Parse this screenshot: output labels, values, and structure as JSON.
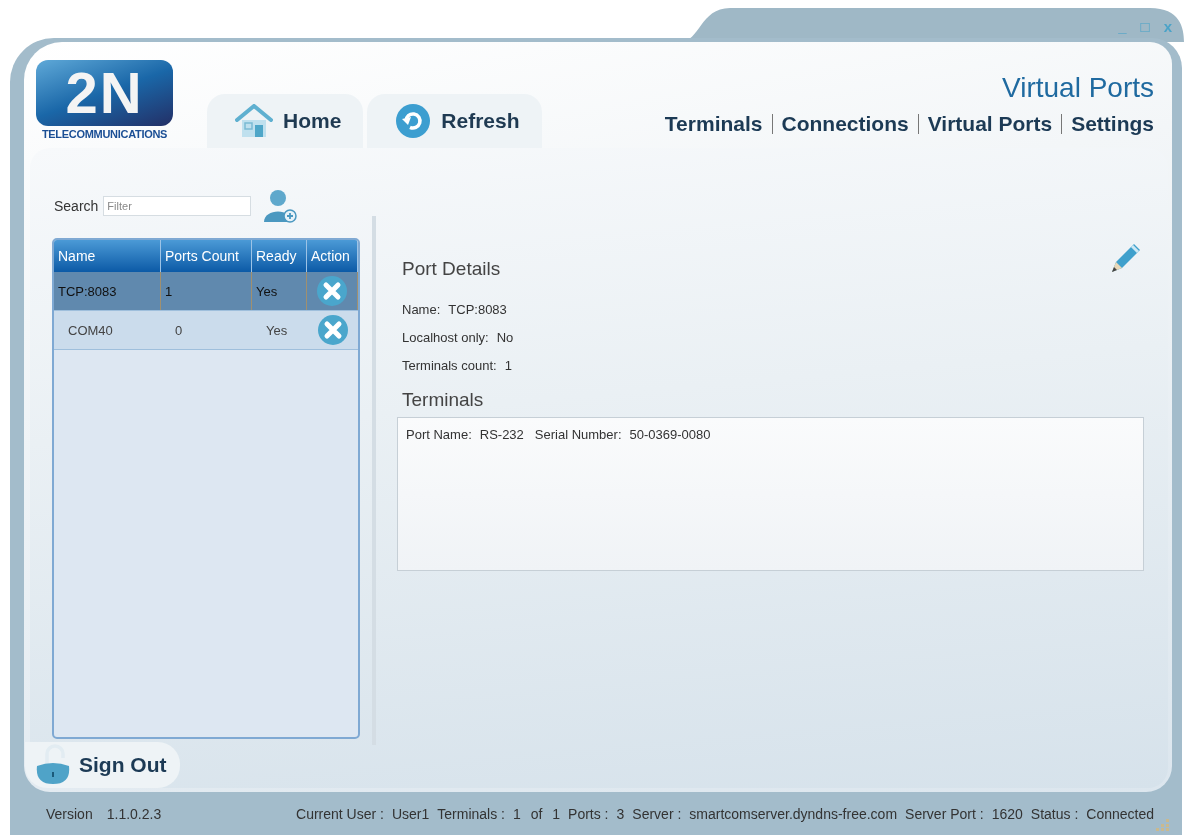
{
  "logo": {
    "mark": "2N",
    "caption": "TELECOMMUNICATIONS"
  },
  "window_controls": [
    "_",
    "□",
    "x"
  ],
  "toolbar": [
    {
      "label": "Home",
      "kind": "home"
    },
    {
      "label": "Refresh",
      "kind": "refresh"
    }
  ],
  "page_title": "Virtual Ports",
  "nav": [
    "Terminals",
    "Connections",
    "Virtual Ports",
    "Settings"
  ],
  "search": {
    "label": "Search",
    "placeholder": "Filter"
  },
  "table": {
    "columns": [
      "Name",
      "Ports Count",
      "Ready",
      "Action"
    ],
    "rows": [
      {
        "name": "TCP:8083",
        "ports_count": "1",
        "ready": "Yes",
        "selected": true
      },
      {
        "name": "COM40",
        "ports_count": "0",
        "ready": "Yes",
        "selected": false
      }
    ]
  },
  "details": {
    "title": "Port Details",
    "fields": [
      {
        "label": "Name:",
        "value": "TCP:8083"
      },
      {
        "label": "Localhost only:",
        "value": "No"
      },
      {
        "label": "Terminals count:",
        "value": "1"
      }
    ],
    "terminals_title": "Terminals",
    "terminals": [
      {
        "fields": [
          {
            "label": "Port Name:",
            "value": "RS-232"
          },
          {
            "label": "Serial Number:",
            "value": "50-0369-0080"
          }
        ]
      }
    ]
  },
  "sign_out": "Sign Out",
  "status_bar": {
    "version_label": "Version",
    "version": "1.1.0.2.3",
    "items": [
      {
        "label": "Current User :",
        "value": "User1"
      },
      {
        "label": "Terminals :",
        "value": "1 of 1"
      },
      {
        "label": "Ports :",
        "value": "3"
      },
      {
        "label": "Server :",
        "value": "smartcomserver.dyndns-free.com"
      },
      {
        "label": "Server Port :",
        "value": "1620"
      },
      {
        "label": "Status :",
        "value": "Connected"
      }
    ]
  }
}
